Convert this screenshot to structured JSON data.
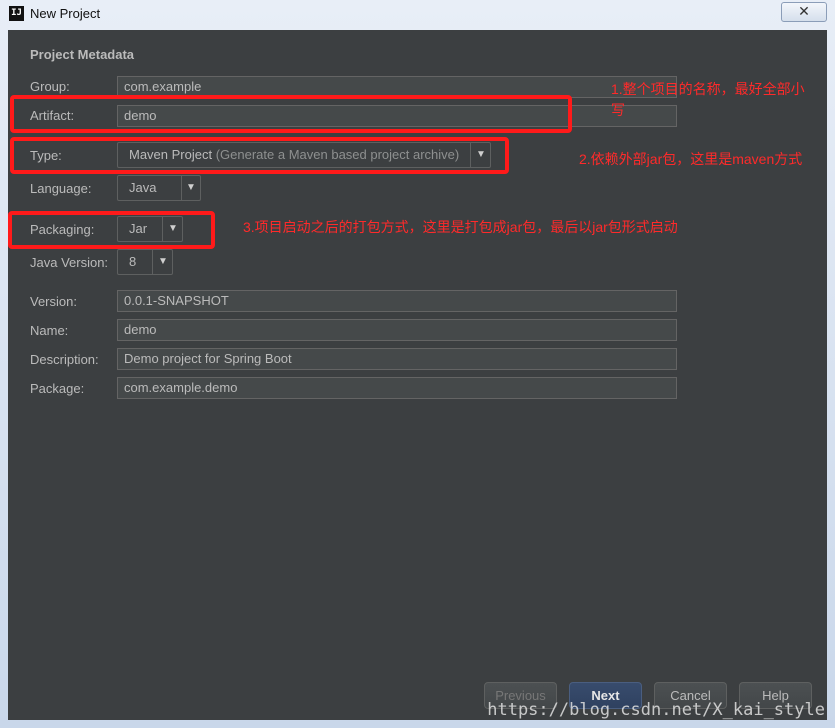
{
  "window": {
    "title": "New Project",
    "app_icon": "IJ",
    "close_glyph": "✕"
  },
  "section": {
    "title": "Project Metadata"
  },
  "form": {
    "group": {
      "label": "Group:",
      "value": "com.example"
    },
    "artifact": {
      "label": "Artifact:",
      "value": "demo"
    },
    "type": {
      "label": "Type:",
      "value": "Maven Project",
      "hint": "(Generate a Maven based project archive)"
    },
    "language": {
      "label": "Language:",
      "value": "Java"
    },
    "packaging": {
      "label": "Packaging:",
      "value": "Jar"
    },
    "java_version": {
      "label": "Java Version:",
      "value": "8"
    },
    "version": {
      "label": "Version:",
      "value": "0.0.1-SNAPSHOT"
    },
    "name": {
      "label": "Name:",
      "value": "demo"
    },
    "description": {
      "label": "Description:",
      "value": "Demo project for Spring Boot"
    },
    "package": {
      "label": "Package:",
      "value": "com.example.demo"
    }
  },
  "annotations": {
    "note1": "1.整个项目的名称，最好全部小写",
    "note2": "2.依赖外部jar包，这里是maven方式",
    "note3": "3.项目启动之后的打包方式，这里是打包成jar包，最后以jar包形式启动"
  },
  "buttons": {
    "previous": "Previous",
    "next": "Next",
    "cancel": "Cancel",
    "help": "Help"
  },
  "icons": {
    "dropdown": "chevron-down-icon"
  },
  "watermark": "https://blog.csdn.net/X_kai_style",
  "colors": {
    "panel": "#3c3f41",
    "annotation": "#ff1a1a",
    "accent": "#2f4160"
  }
}
